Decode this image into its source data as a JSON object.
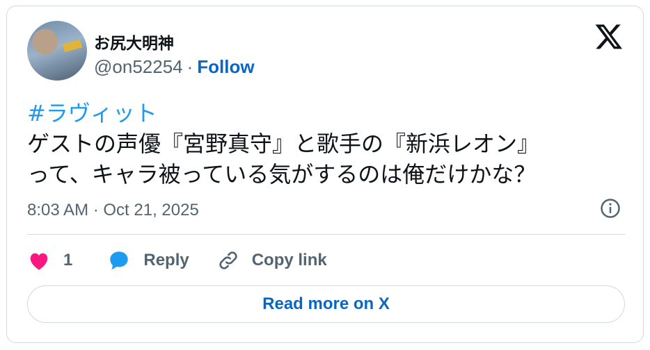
{
  "author": {
    "name": "お尻大明神",
    "handle": "@on52254",
    "separator": "·",
    "follow_label": "Follow"
  },
  "post": {
    "hashtag": "#ラヴィット",
    "line1": "ゲストの声優『宮野真守』と歌手の『新浜レオン』",
    "line2": "って、キャラ被っている気がするのは俺だけかな？",
    "timestamp": "8:03 AM · Oct 21, 2025"
  },
  "actions": {
    "like_count": "1",
    "reply_label": "Reply",
    "copy_label": "Copy link"
  },
  "read_more_label": "Read more on X",
  "icons": {
    "platform": "x-logo-icon",
    "info": "info-icon",
    "like": "heart-icon",
    "reply": "speech-bubble-icon",
    "copy": "link-icon"
  },
  "colors": {
    "link": "#0a66c2",
    "hashtag": "#1d9bf0",
    "heart": "#f91880",
    "reply_bubble": "#1d9bf0",
    "muted": "#536471"
  }
}
